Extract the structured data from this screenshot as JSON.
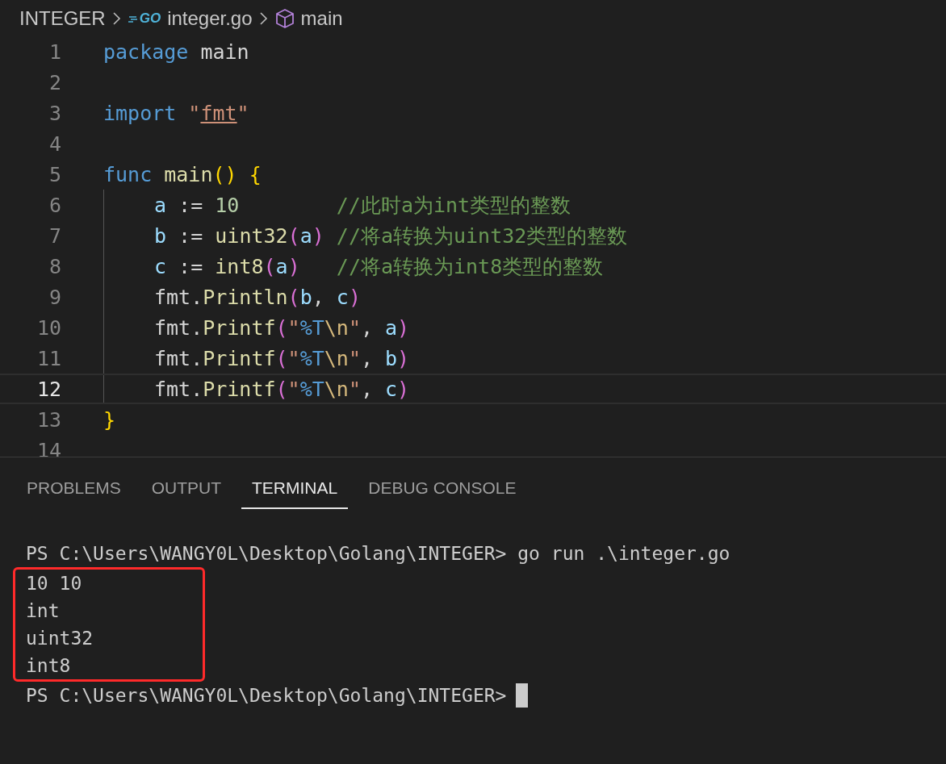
{
  "breadcrumb": [
    {
      "kind": "folder",
      "label": "INTEGER"
    },
    {
      "kind": "file",
      "label": "integer.go",
      "icon_text": "GO"
    },
    {
      "kind": "symbol",
      "label": "main"
    }
  ],
  "editor": {
    "lines": [
      {
        "number": "1",
        "active": false,
        "tokens": [
          {
            "kind": "keyword",
            "text": "package"
          },
          {
            "kind": "plain",
            "text": " main"
          }
        ]
      },
      {
        "number": "2",
        "active": false
      },
      {
        "number": "3",
        "active": false,
        "tokens": [
          {
            "kind": "keyword",
            "text": "import "
          },
          {
            "kind": "string",
            "text": "\""
          },
          {
            "kind": "link",
            "text": "fmt"
          },
          {
            "kind": "string",
            "text": "\""
          }
        ]
      },
      {
        "number": "4",
        "active": false
      },
      {
        "number": "5",
        "active": false,
        "tokens": [
          {
            "kind": "keyword",
            "text": "func "
          },
          {
            "kind": "function",
            "text": "main"
          },
          {
            "kind": "bracket",
            "text": "()"
          },
          {
            "kind": "bracket",
            "text": " {"
          }
        ],
        "children": [
          {
            "number": "6",
            "active": false,
            "tokens": [
              {
                "kind": "variable",
                "text": "a"
              },
              {
                "kind": "plain",
                "text": " := "
              },
              {
                "kind": "number",
                "text": "10        "
              },
              {
                "kind": "comment",
                "text": "//此时a为int类型的整数"
              }
            ]
          },
          {
            "number": "7",
            "active": false,
            "tokens": [
              {
                "kind": "variable",
                "text": "b"
              },
              {
                "kind": "plain",
                "text": " := "
              },
              {
                "kind": "function",
                "text": "uint32"
              },
              {
                "kind": "paren",
                "text": "("
              },
              {
                "kind": "variable",
                "text": "a"
              },
              {
                "kind": "paren",
                "text": ") "
              },
              {
                "kind": "comment",
                "text": "//将a转换为uint32类型的整数"
              }
            ]
          },
          {
            "number": "8",
            "active": false,
            "tokens": [
              {
                "kind": "variable",
                "text": "c"
              },
              {
                "kind": "plain",
                "text": " := "
              },
              {
                "kind": "function",
                "text": "int8"
              },
              {
                "kind": "paren",
                "text": "("
              },
              {
                "kind": "variable",
                "text": "a"
              },
              {
                "kind": "paren",
                "text": ")   "
              },
              {
                "kind": "comment",
                "text": "//将a转换为int8类型的整数"
              }
            ]
          },
          {
            "number": "9",
            "active": false,
            "tokens": [
              {
                "kind": "plain",
                "text": "fmt."
              },
              {
                "kind": "function",
                "text": "Println"
              },
              {
                "kind": "paren",
                "text": "("
              },
              {
                "kind": "variable",
                "text": "b"
              },
              {
                "kind": "plain",
                "text": ", "
              },
              {
                "kind": "variable",
                "text": "c"
              },
              {
                "kind": "paren",
                "text": ")"
              }
            ]
          },
          {
            "number": "10",
            "active": false,
            "tokens": [
              {
                "kind": "plain",
                "text": "fmt."
              },
              {
                "kind": "function",
                "text": "Printf"
              },
              {
                "kind": "paren",
                "text": "("
              },
              {
                "kind": "string",
                "text": "\""
              },
              {
                "kind": "format",
                "text": "%T"
              },
              {
                "kind": "escape",
                "text": "\\n"
              },
              {
                "kind": "string",
                "text": "\""
              },
              {
                "kind": "plain",
                "text": ", "
              },
              {
                "kind": "variable",
                "text": "a"
              },
              {
                "kind": "paren",
                "text": ")"
              }
            ]
          },
          {
            "number": "11",
            "active": false,
            "tokens": [
              {
                "kind": "plain",
                "text": "fmt."
              },
              {
                "kind": "function",
                "text": "Printf"
              },
              {
                "kind": "paren",
                "text": "("
              },
              {
                "kind": "string",
                "text": "\""
              },
              {
                "kind": "format",
                "text": "%T"
              },
              {
                "kind": "escape",
                "text": "\\n"
              },
              {
                "kind": "string",
                "text": "\""
              },
              {
                "kind": "plain",
                "text": ", "
              },
              {
                "kind": "variable",
                "text": "b"
              },
              {
                "kind": "paren",
                "text": ")"
              }
            ]
          },
          {
            "number": "12",
            "active": true,
            "tokens": [
              {
                "kind": "plain",
                "text": "fmt."
              },
              {
                "kind": "function",
                "text": "Printf"
              },
              {
                "kind": "paren",
                "text": "("
              },
              {
                "kind": "string",
                "text": "\""
              },
              {
                "kind": "format",
                "text": "%T"
              },
              {
                "kind": "escape",
                "text": "\\n"
              },
              {
                "kind": "string",
                "text": "\""
              },
              {
                "kind": "plain",
                "text": ", "
              },
              {
                "kind": "variable",
                "text": "c"
              },
              {
                "kind": "paren",
                "text": ")"
              }
            ]
          }
        ]
      },
      {
        "number": "13",
        "active": false,
        "tokens": [
          {
            "kind": "bracket",
            "text": "}"
          }
        ]
      },
      {
        "number": "14",
        "active": false
      }
    ]
  },
  "panel": {
    "tabs": [
      {
        "label": "PROBLEMS",
        "selected": false
      },
      {
        "label": "OUTPUT",
        "selected": false
      },
      {
        "label": "TERMINAL",
        "selected": true
      },
      {
        "label": "DEBUG CONSOLE",
        "selected": false
      }
    ],
    "terminal": [
      {
        "highlighted": false,
        "lines": [
          {
            "text": "PS C:\\Users\\WANGY0L\\Desktop\\Golang\\INTEGER> go run .\\integer.go",
            "cursor": false
          }
        ]
      },
      {
        "highlighted": true,
        "lines": [
          {
            "text": "10 10",
            "cursor": false
          },
          {
            "text": "int",
            "cursor": false
          },
          {
            "text": "uint32",
            "cursor": false
          },
          {
            "text": "int8",
            "cursor": false
          }
        ]
      },
      {
        "highlighted": false,
        "lines": [
          {
            "text": "PS C:\\Users\\WANGY0L\\Desktop\\Golang\\INTEGER>",
            "cursor": true
          }
        ]
      }
    ]
  }
}
